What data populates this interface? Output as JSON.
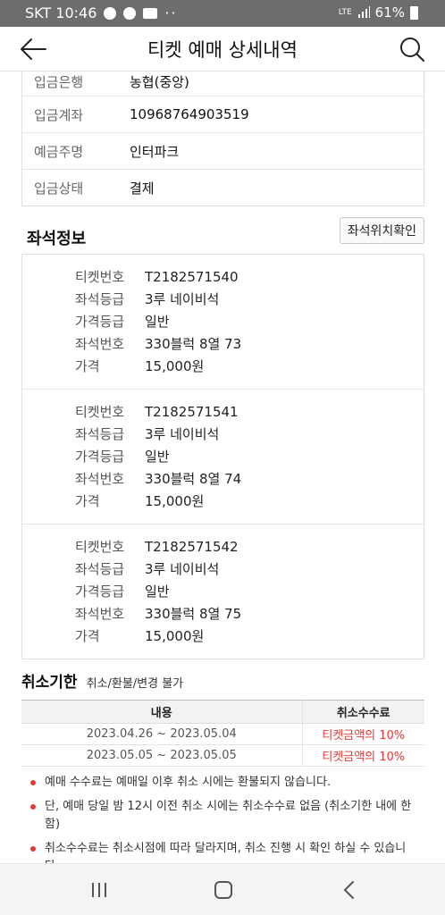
{
  "status_bar": {
    "carrier_time": "SKT 10:46",
    "network": "LTE",
    "battery": "61%"
  },
  "header": {
    "title": "티켓 예매 상세내역"
  },
  "deposit": [
    {
      "label": "입금은행",
      "value": "농협(중앙)"
    },
    {
      "label": "입금계좌",
      "value": "10968764903519"
    },
    {
      "label": "예금주명",
      "value": "인터파크"
    },
    {
      "label": "입금상태",
      "value": "결제"
    }
  ],
  "seat_info": {
    "title": "좌석정보",
    "location_button": "좌석위치확인",
    "labels": {
      "ticket_no": "티켓번호",
      "seat_grade": "좌석등급",
      "price_grade": "가격등급",
      "seat_no": "좌석번호",
      "price": "가격"
    },
    "tickets": [
      {
        "ticket_no": "T2182571540",
        "seat_grade": "3루 네이비석",
        "price_grade": "일반",
        "seat_no": "330블럭 8열 73",
        "price": "15,000원"
      },
      {
        "ticket_no": "T2182571541",
        "seat_grade": "3루 네이비석",
        "price_grade": "일반",
        "seat_no": "330블럭 8열 74",
        "price": "15,000원"
      },
      {
        "ticket_no": "T2182571542",
        "seat_grade": "3루 네이비석",
        "price_grade": "일반",
        "seat_no": "330블럭 8열 75",
        "price": "15,000원"
      }
    ]
  },
  "cancel": {
    "title": "취소기한",
    "note": "취소/환불/변경 불가",
    "table": {
      "headers": [
        "내용",
        "취소수수료"
      ],
      "rows": [
        [
          "2023.04.26 ~ 2023.05.04",
          "티켓금액의 10%"
        ],
        [
          "2023.05.05 ~ 2023.05.05",
          "티켓금액의 10%"
        ]
      ]
    },
    "notes": [
      "예매 수수료는 예매일 이후 취소 시에는 환불되지 않습니다.",
      "단, 예매 당일 밤 12시 이전 취소 시에는 취소수수료 없음 (취소기한 내에 한함)",
      "취소수수료는 취소시점에 따라 달라지며, 취소 진행 시 확인 하실 수 있습니다."
    ]
  },
  "colors": {
    "accent_red": "#e53a3a",
    "status_bar": "#6d6d6d"
  }
}
